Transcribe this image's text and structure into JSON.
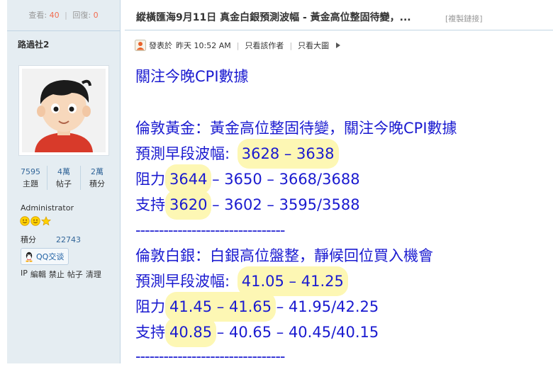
{
  "sidebar": {
    "view_label": "查看:",
    "view_count": "40",
    "reply_label": "回復:",
    "reply_count": "0",
    "username": "路過社2",
    "stats": [
      {
        "value": "7595",
        "label": "主題"
      },
      {
        "value": "4萬",
        "label": "帖子"
      },
      {
        "value": "2萬",
        "label": "積分"
      }
    ],
    "role": "Administrator",
    "points_label": "積分",
    "points_value": "22743",
    "qq_label": "QQ交谈",
    "admin_links": [
      "IP",
      "編輯",
      "禁止",
      "帖子",
      "清理"
    ]
  },
  "thread": {
    "title": "縱橫匯海9月11日 真金白銀預測波幅 - 黃金高位整固待變，...",
    "copy_link": "[複製鏈接]"
  },
  "post_meta": {
    "posted_label": "發表於",
    "posted_time": "昨天 10:52 AM",
    "author_only": "只看該作者",
    "large_image": "只看大圖"
  },
  "post": {
    "heading": "關注今晚CPI數據",
    "gold": {
      "title": "倫敦黃金：黃金高位整固待變，關注今晚CPI數據",
      "range_label": "預測早段波幅:",
      "range_value": "3628 – 3638",
      "resistance_label": "阻力",
      "resistance_hl": "3644",
      "resistance_rest": " – 3650 – 3668/3688",
      "support_label": "支持",
      "support_hl": "3620",
      "support_rest": " – 3602 – 3595/3588"
    },
    "divider": "--------------------------------",
    "silver": {
      "title": "倫敦白銀：白銀高位盤整，靜候回位買入機會",
      "range_label": "預測早段波幅:",
      "range_value": "41.05 – 41.25",
      "resistance_label": "阻力",
      "resistance_hl": "41.45 – 41.65",
      "resistance_rest": " – 41.95/42.25",
      "support_label": "支持",
      "support_hl": "40.85",
      "support_rest": " – 40.65 – 40.45/40.15"
    },
    "divider2": "--------------------------------"
  }
}
